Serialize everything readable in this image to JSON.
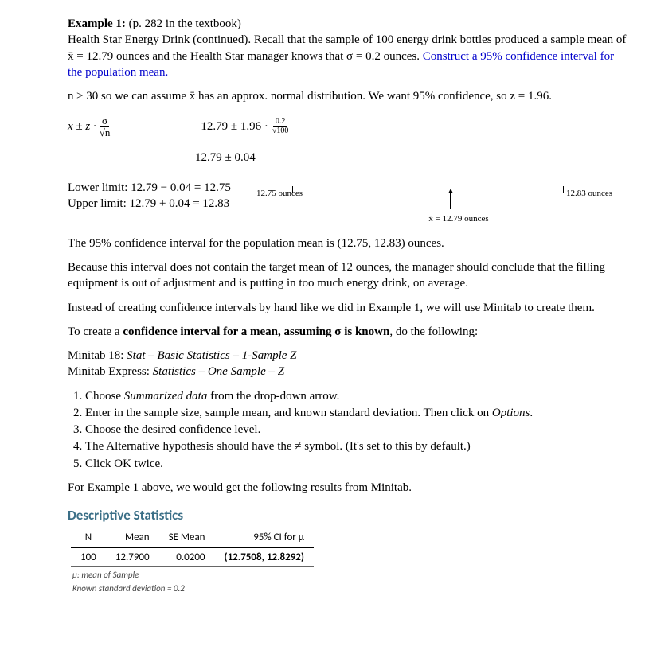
{
  "header": {
    "title_label": "Example 1:",
    "title_ref": "(p. 282 in the textbook)",
    "intro_a": "Health Star Energy Drink (continued). Recall that the sample of 100 energy drink bottles produced a sample mean of x̄ = 12.79 ounces and the Health Star manager knows that σ = 0.2 ounces. ",
    "intro_b": "Construct a 95% confidence interval for the population mean."
  },
  "assumption": "n ≥ 30 so we can assume x̄ has an approx. normal distribution.  We want 95% confidence, so z = 1.96.",
  "formula": {
    "lhs_a": "x̄  ±  z ·",
    "frac_num": "σ",
    "frac_den": "√n",
    "rhs_a": "12.79 ± 1.96 ·",
    "small_num": "0.2",
    "small_den": "√100",
    "result": "12.79 ± 0.04"
  },
  "limits": {
    "lower": "Lower limit:  12.79 − 0.04 = 12.75",
    "upper": "Upper limit:  12.79 + 0.04 = 12.83"
  },
  "diagram": {
    "left": "12.75 ounces",
    "right": "12.83 ounces",
    "center": "x̄ = 12.79 ounces"
  },
  "conclusion1": "The 95% confidence interval for the population mean is (12.75, 12.83) ounces.",
  "conclusion2": "Because this interval does not contain the target mean of 12 ounces, the manager should conclude that the filling equipment is out of adjustment and is putting in too much energy drink, on average.",
  "conclusion3": "Instead of creating confidence intervals by hand like we did in Example 1, we will use Minitab to create them.",
  "howto_lead_a": "To create a ",
  "howto_lead_b": "confidence interval for a mean, assuming σ is known",
  "howto_lead_c": ", do the following:",
  "menus": {
    "m18_a": "Minitab 18:  ",
    "m18_b": "Stat – Basic Statistics – 1-Sample Z",
    "me_a": "Minitab Express:  ",
    "me_b": "Statistics – One Sample – Z"
  },
  "steps": [
    {
      "a": "Choose ",
      "b": "Summarized data",
      "c": " from the drop-down arrow."
    },
    {
      "a": "Enter in the sample size, sample mean, and known standard deviation.  Then click on ",
      "b": "Options",
      "c": "."
    },
    {
      "a": "Choose the desired confidence level.",
      "b": "",
      "c": ""
    },
    {
      "a": "The Alternative hypothesis should have the ≠ symbol.  (It's set to this by default.)",
      "b": "",
      "c": ""
    },
    {
      "a": "Click OK twice.",
      "b": "",
      "c": ""
    }
  ],
  "results_lead": "For Example 1 above, we would get the following results from Minitab.",
  "minitab": {
    "title": "Descriptive Statistics",
    "headers": [
      "N",
      "Mean",
      "SE Mean",
      "95% CI for μ"
    ],
    "row": [
      "100",
      "12.7900",
      "0.0200",
      "(12.7508, 12.8292)"
    ],
    "note1": "μ: mean of Sample",
    "note2": "Known standard deviation = 0.2"
  }
}
